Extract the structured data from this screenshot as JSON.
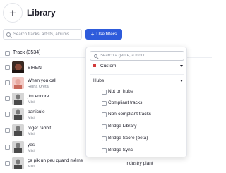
{
  "header": {
    "add_icon": "plus-icon",
    "title": "Library"
  },
  "toolbar": {
    "search_placeholder": "Search tracks, artists, albums...",
    "filters_label": "Use filters",
    "filters_icon": "plus-icon",
    "accent": "#2e5bdb"
  },
  "table": {
    "column_track": "Track (3534)",
    "rows": [
      {
        "title": "SIREN",
        "artist": "",
        "extra": ""
      },
      {
        "title": "When you call",
        "artist": "Reina Oreta",
        "extra": ""
      },
      {
        "title": "jtm encore",
        "artist": "Miki",
        "extra": ""
      },
      {
        "title": "particule",
        "artist": "Miki",
        "extra": ""
      },
      {
        "title": "roger rabbit",
        "artist": "Miki",
        "extra": ""
      },
      {
        "title": "yes",
        "artist": "Miki",
        "extra": ""
      },
      {
        "title": "ça pik un peu quand même",
        "artist": "Miki",
        "extra": "industry plant"
      }
    ]
  },
  "filters_menu": {
    "search_placeholder": "Search a genre, a mood...",
    "custom_label": "Custom",
    "hubs_label": "Hubs",
    "options": [
      "Not on hubs",
      "Compliant tracks",
      "Non-compliant tracks",
      "Bridge Library",
      "Bridge Score (beta)",
      "Bridge Sync"
    ]
  }
}
